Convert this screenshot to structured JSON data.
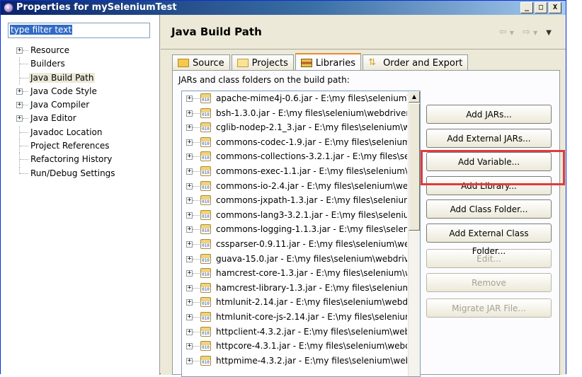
{
  "window": {
    "title": "Properties for mySeleniumTest",
    "controls": {
      "minimize": "_",
      "maximize": "□",
      "close": "X"
    }
  },
  "filter": {
    "value": "type filter text"
  },
  "nav_tree": [
    {
      "label": "Resource",
      "expandable": true
    },
    {
      "label": "Builders",
      "expandable": false
    },
    {
      "label": "Java Build Path",
      "expandable": false,
      "selected": true
    },
    {
      "label": "Java Code Style",
      "expandable": true
    },
    {
      "label": "Java Compiler",
      "expandable": true
    },
    {
      "label": "Java Editor",
      "expandable": true
    },
    {
      "label": "Javadoc Location",
      "expandable": false
    },
    {
      "label": "Project References",
      "expandable": false
    },
    {
      "label": "Refactoring History",
      "expandable": false
    },
    {
      "label": "Run/Debug Settings",
      "expandable": false
    }
  ],
  "page": {
    "title": "Java Build Path",
    "nav_back": "⇦",
    "nav_forward": "⇨",
    "nav_menu": "▼"
  },
  "tabs": [
    {
      "label": "Source",
      "icon": "source-icon"
    },
    {
      "label": "Projects",
      "icon": "projects-icon"
    },
    {
      "label": "Libraries",
      "icon": "libraries-icon",
      "active": true
    },
    {
      "label": "Order and Export",
      "icon": "order-icon"
    }
  ],
  "libraries": {
    "label": "JARs and class folders on the build path:",
    "items": [
      "apache-mime4j-0.6.jar - E:\\my files\\selenium\\w",
      "bsh-1.3.0.jar - E:\\my files\\selenium\\webdriver\\",
      "cglib-nodep-2.1_3.jar - E:\\my files\\selenium\\we",
      "commons-codec-1.9.jar - E:\\my files\\selenium\\",
      "commons-collections-3.2.1.jar - E:\\my files\\sele",
      "commons-exec-1.1.jar - E:\\my files\\selenium\\w",
      "commons-io-2.4.jar - E:\\my files\\selenium\\webd",
      "commons-jxpath-1.3.jar - E:\\my files\\selenium\\",
      "commons-lang3-3.2.1.jar - E:\\my files\\seleniun",
      "commons-logging-1.1.3.jar - E:\\my files\\seleni",
      "cssparser-0.9.11.jar - E:\\my files\\selenium\\wel",
      "guava-15.0.jar - E:\\my files\\selenium\\webdrive",
      "hamcrest-core-1.3.jar - E:\\my files\\selenium\\w",
      "hamcrest-library-1.3.jar - E:\\my files\\selenium\\",
      "htmlunit-2.14.jar - E:\\my files\\selenium\\webdri",
      "htmlunit-core-js-2.14.jar - E:\\my files\\selenium",
      "httpclient-4.3.2.jar - E:\\my files\\selenium\\webc",
      "httpcore-4.3.1.jar - E:\\my files\\selenium\\webd",
      "httpmime-4.3.2.jar - E:\\my files\\selenium\\webc"
    ]
  },
  "buttons": [
    {
      "label": "Add JARs...",
      "enabled": true
    },
    {
      "label": "Add External JARs...",
      "enabled": true
    },
    {
      "label": "Add Variable...",
      "enabled": true
    },
    {
      "label": "Add Library...",
      "enabled": true,
      "highlighted": true
    },
    {
      "label": "Add Class Folder...",
      "enabled": true
    },
    {
      "label": "Add External Class Folder...",
      "enabled": true
    },
    {
      "label": "Edit...",
      "enabled": false
    },
    {
      "label": "Remove",
      "enabled": false
    },
    {
      "label": "Migrate JAR File...",
      "enabled": false
    }
  ],
  "colors": {
    "highlight": "#e03b3b",
    "active_tab": "#e68b2c",
    "selection": "#316ac5"
  }
}
